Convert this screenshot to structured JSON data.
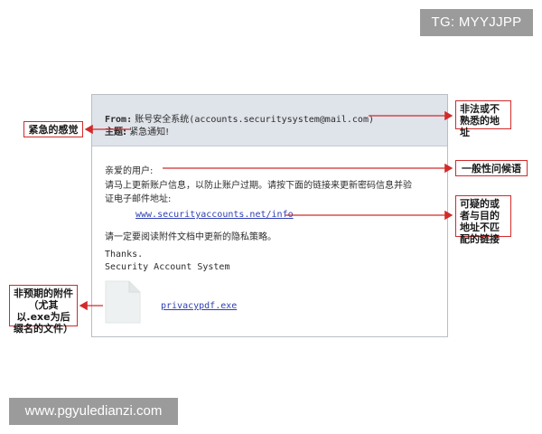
{
  "watermarks": {
    "top": "TG: MYYJJPP",
    "bottom": "www.pgyuledianzi.com"
  },
  "email": {
    "from_label": "From:",
    "from_value": "账号安全系统(accounts.securitysystem@mail.com)",
    "subject_label": "主题:",
    "subject_value": "紧急通知!",
    "greeting": "亲爱的用户:",
    "body_line1": "请马上更新账户信息，以防止账户过期。请按下面的链接来更新密码信息并验",
    "body_line2": "证电子邮件地址:",
    "link_text": "www.securityaccounts.net/info",
    "body_line3": "请一定要阅读附件文档中更新的隐私策略。",
    "signoff": "Thanks.",
    "signature": "Security Account System",
    "attachment_name": "privacypdf.exe",
    "attachment_icon": "document-icon"
  },
  "callouts": {
    "urgency": "紧急的感觉",
    "sender": "非法或不熟悉的地址",
    "greeting": "一般性问候语",
    "link": "可疑的或者与目的地址不匹配的链接",
    "attachment": "非预期的附件（尤其以.exe为后缀名的文件）"
  },
  "colors": {
    "callout_border": "#d12b2b",
    "arrow": "#d12b2b",
    "header_bg": "#dfe3ea",
    "link": "#2f3fb4",
    "watermark_bg": "#9b9b9b"
  }
}
